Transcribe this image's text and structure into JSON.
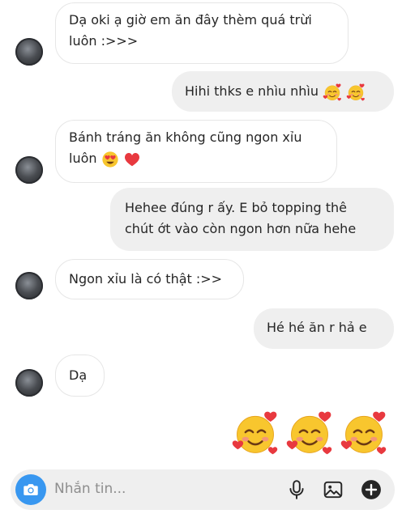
{
  "messages": [
    {
      "side": "in",
      "text": "Dạ oki ạ giờ em ăn đây thèm quá trừi luôn :>>>"
    },
    {
      "side": "out",
      "text": "Hihi thks e nhìu nhìu"
    },
    {
      "side": "in",
      "text": "Bánh tráng ăn không cũng ngon xỉu luôn"
    },
    {
      "side": "out",
      "text": "Hehee đúng r ấy. E bỏ topping thê chút ớt vào còn ngon hơn nữa hehe"
    },
    {
      "side": "in",
      "text": "Ngon xỉu là có thật :>>"
    },
    {
      "side": "out",
      "text": "Hé hé ăn r hả e"
    },
    {
      "side": "in",
      "text": "Dạ"
    }
  ],
  "reaction_emojis": [
    "smiling-face-with-hearts-emoji",
    "smiling-face-with-hearts-emoji",
    "smiling-face-with-hearts-emoji"
  ],
  "composer": {
    "placeholder": "Nhắn tin..."
  },
  "icons": {
    "camera": "camera-icon",
    "mic": "microphone-icon",
    "gallery": "gallery-icon",
    "add": "plus-icon"
  },
  "colors": {
    "accent": "#3897f0",
    "outgoing_bubble": "#efefef",
    "incoming_border": "#e6e6e6"
  }
}
